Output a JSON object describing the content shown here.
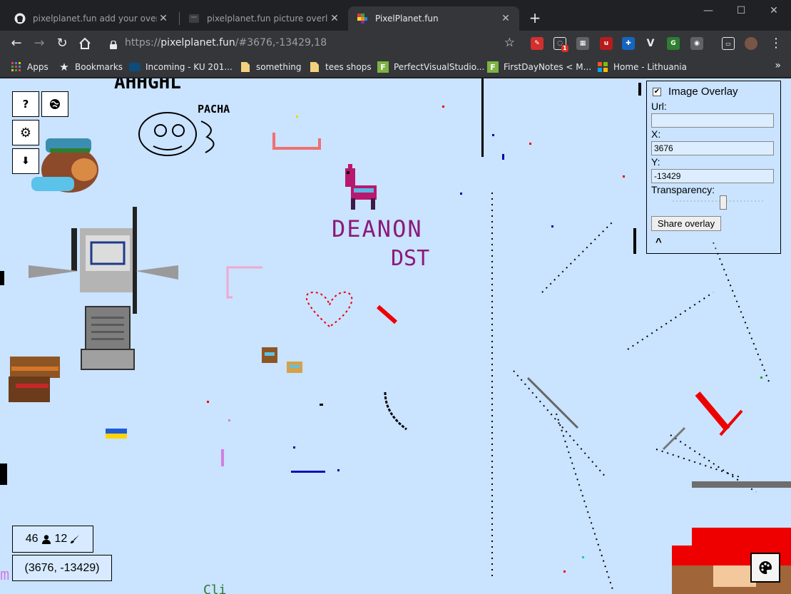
{
  "tabs": [
    {
      "title": "pixelplanet.fun add your overlay",
      "favicon": "github-icon",
      "active": false
    },
    {
      "title": "pixelplanet.fun picture overlay",
      "favicon": "generic-page-icon",
      "active": false
    },
    {
      "title": "PixelPlanet.fun",
      "favicon": "pixelplanet-icon",
      "active": true
    }
  ],
  "window_controls": {
    "minimize": "—",
    "maximize": "☐",
    "close": "✕"
  },
  "address_bar": {
    "scheme": "https://",
    "host": "pixelplanet.fun",
    "path": "/#3676,-13429,18"
  },
  "extensions": {
    "badge_count": "1"
  },
  "bookmarks": [
    {
      "label": "Apps",
      "icon": "apps-grid-icon"
    },
    {
      "label": "Bookmarks",
      "icon": "star-icon"
    },
    {
      "label": "Incoming - KU 201...",
      "icon": "mail-icon"
    },
    {
      "label": "something",
      "icon": "folder-icon"
    },
    {
      "label": "tees shops",
      "icon": "folder-icon"
    },
    {
      "label": "PerfectVisualStudio...",
      "icon": "f-icon"
    },
    {
      "label": "FirstDayNotes < M...",
      "icon": "f-icon"
    },
    {
      "label": "Home - Lithuania",
      "icon": "microsoft-icon"
    }
  ],
  "canvas": {
    "art_text": {
      "top_word": "AHHGHL",
      "small_word": "PACHA",
      "deanon": "DEANON",
      "dst": "DST"
    },
    "left_controls": [
      {
        "label": "?",
        "name": "help-button"
      },
      {
        "label": "◍",
        "name": "globe-button"
      },
      {
        "label": "⚙",
        "name": "settings-button"
      },
      {
        "label": "⬇",
        "name": "download-button"
      }
    ],
    "overlay": {
      "title": "Image Overlay",
      "checked": "✔",
      "url_label": "Url:",
      "url_value": "",
      "x_label": "X:",
      "x_value": "3676",
      "y_label": "Y:",
      "y_value": "-13429",
      "transparency_label": "Transparency:",
      "share_label": "Share overlay",
      "collapse_label": "^"
    },
    "online_count": "46",
    "pixel_count": "12",
    "coordinates": "(3676, -13429)"
  }
}
